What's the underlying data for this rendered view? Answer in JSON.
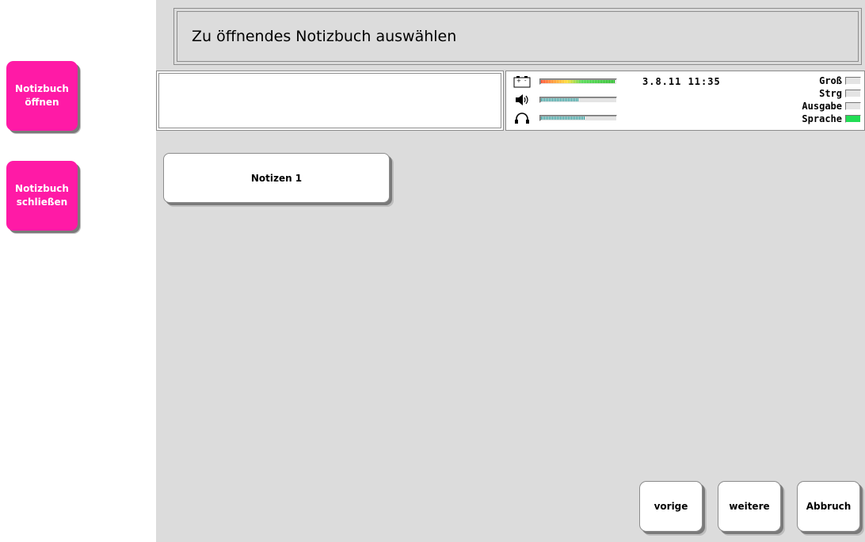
{
  "sidebar": {
    "open_label": "Notizbuch\nöffnen",
    "close_label": "Notizbuch\nschließen"
  },
  "header": {
    "title": "Zu öffnendes Notizbuch auswählen"
  },
  "status": {
    "datetime": "3.8.11 11:35",
    "battery_level": 0.99,
    "volume_level": 0.5,
    "headphone_level": 0.6,
    "flags": [
      {
        "label": "Groß",
        "active": false
      },
      {
        "label": "Strg",
        "active": false
      },
      {
        "label": "Ausgabe",
        "active": false
      },
      {
        "label": "Sprache",
        "active": true
      }
    ]
  },
  "notebooks": [
    {
      "label": "Notizen 1"
    }
  ],
  "footer": {
    "prev_label": "vorige",
    "next_label": "weitere",
    "cancel_label": "Abbruch"
  },
  "colors": {
    "side_button": "#ff1aa6",
    "active_flag": "#22dd55",
    "volume_meter": "#199999"
  }
}
